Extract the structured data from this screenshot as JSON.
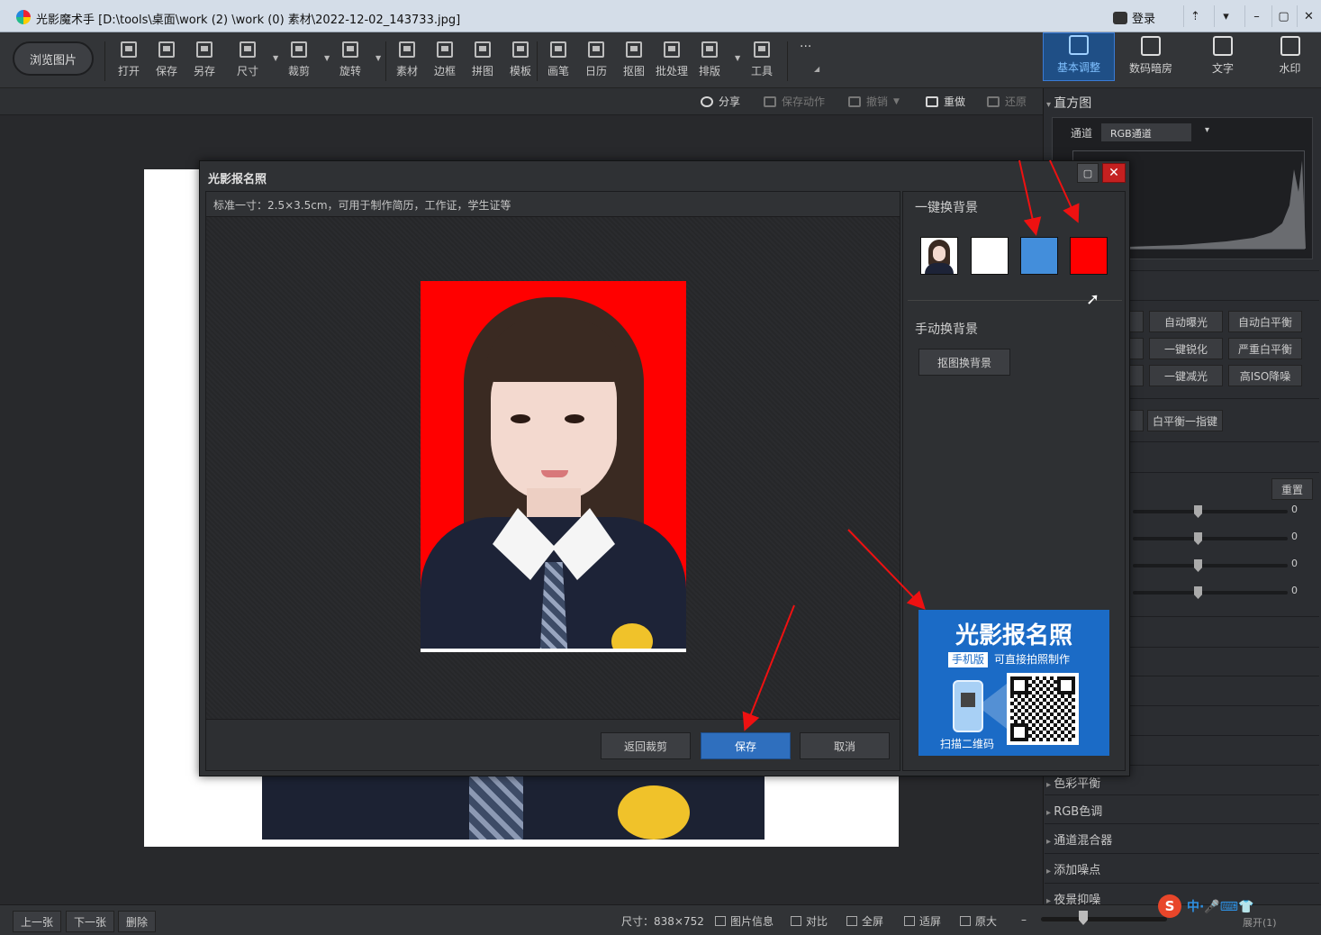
{
  "window": {
    "title": "光影魔术手 [D:\\tools\\桌面\\work (2) \\work (0) 素材\\2022-12-02_143733.jpg]",
    "login_label": "登录",
    "controls": [
      "⇡",
      "▾",
      "–",
      "▢",
      "✕"
    ]
  },
  "toolbar": {
    "browse_label": "浏览图片",
    "tools": [
      {
        "label": "打开",
        "icon": "open-icon"
      },
      {
        "label": "保存",
        "icon": "save-icon"
      },
      {
        "label": "另存",
        "icon": "save-as-icon"
      },
      {
        "label": "尺寸",
        "icon": "resize-icon"
      },
      {
        "label": "裁剪",
        "icon": "crop-icon"
      },
      {
        "label": "旋转",
        "icon": "rotate-icon"
      },
      {
        "label": "素材",
        "icon": "material-icon"
      },
      {
        "label": "边框",
        "icon": "border-icon"
      },
      {
        "label": "拼图",
        "icon": "collage-icon"
      },
      {
        "label": "模板",
        "icon": "template-icon"
      },
      {
        "label": "画笔",
        "icon": "brush-icon"
      },
      {
        "label": "日历",
        "icon": "calendar-icon"
      },
      {
        "label": "抠图",
        "icon": "cutout-icon"
      },
      {
        "label": "批处理",
        "icon": "batch-icon"
      },
      {
        "label": "排版",
        "icon": "layout-icon"
      },
      {
        "label": "工具",
        "icon": "wrench-icon"
      }
    ],
    "more_label": "···",
    "right_tabs": [
      {
        "label": "基本调整",
        "icon": "adjust-icon",
        "active": true
      },
      {
        "label": "数码暗房",
        "icon": "darkroom-icon",
        "active": false
      },
      {
        "label": "文字",
        "icon": "text-icon",
        "active": false
      },
      {
        "label": "水印",
        "icon": "watermark-icon",
        "active": false
      }
    ]
  },
  "actionbar": {
    "share": "分享",
    "save_action": "保存动作",
    "undo": "撤销",
    "redo": "重做",
    "restore": "还原"
  },
  "right_panel": {
    "histogram_title": "直方图",
    "channel_label": "通道",
    "channel_value": "RGB通道",
    "buttons_grid": [
      "自动曝光",
      "自动白平衡",
      "一键锐化",
      "严重白平衡",
      "一键减光",
      "高ISO降噪"
    ],
    "wb_button": "白平衡一指键",
    "reset_button": "重置",
    "slider_values": [
      "0",
      "0",
      "0",
      "0"
    ],
    "sections": [
      "色彩平衡",
      "RGB色调",
      "通道混合器",
      "添加噪点",
      "夜景抑噪"
    ]
  },
  "dialog": {
    "title": "光影报名照",
    "description": "标准一寸：2.5×3.5cm，可用于制作简历，工作证，学生证等",
    "one_click_bg_title": "一键换背景",
    "manual_bg_title": "手动换背景",
    "cutout_button": "抠图换背景",
    "swatches": [
      {
        "name": "original",
        "color": "#ff0000"
      },
      {
        "name": "white",
        "color": "#ffffff"
      },
      {
        "name": "blue",
        "color": "#438edb"
      },
      {
        "name": "red",
        "color": "#ff0000"
      }
    ],
    "buttons": {
      "back": "返回裁剪",
      "save": "保存",
      "cancel": "取消"
    },
    "promo": {
      "title": "光影报名照",
      "tag": "手机版",
      "subtitle": "可直接拍照制作",
      "scan_label": "扫描二维码"
    }
  },
  "bottombar": {
    "prev": "上一张",
    "next": "下一张",
    "delete": "删除",
    "size": "尺寸：838×752",
    "info": "图片信息",
    "compare": "对比",
    "fullscreen": "全屏",
    "fit": "适屏",
    "original": "原大",
    "expand": "展开(1)"
  },
  "ime": {
    "logo": "S",
    "text": "中·🎤⌨👕"
  }
}
